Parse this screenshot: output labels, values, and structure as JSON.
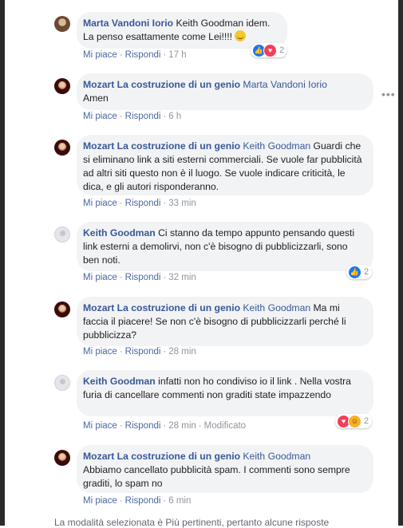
{
  "comments": [
    {
      "author": "Marta Vandoni Iorio",
      "tag": "",
      "text": " Keith Goodman idem. La penso esattamente come Lei!!!! ",
      "like": "Mi piace",
      "reply": "Rispondi",
      "time": "17 h",
      "reactions": {
        "icons": [
          "like-icon",
          "love-icon"
        ],
        "count": "2"
      }
    },
    {
      "author": "Mozart La costruzione di un genio",
      "tag": " Marta Vandoni Iorio",
      "text": "Amen",
      "like": "Mi piace",
      "reply": "Rispondi",
      "time": "6 h"
    },
    {
      "author": "Mozart La costruzione di un genio",
      "tag": " Keith Goodman",
      "text": " Guardi che si eliminano link a siti esterni commerciali. Se vuole far pubblicità ad altri siti questo non è il luogo. Se vuole indicare criticità, le dica, e gli autori risponderanno.",
      "like": "Mi piace",
      "reply": "Rispondi",
      "time": "33 min"
    },
    {
      "author": "Keith Goodman",
      "tag": "",
      "text": " Ci stanno da tempo appunto pensando questi link esterni a demolirvi, non c'è bisogno di pubblicizzarli, sono ben noti.",
      "like": "Mi piace",
      "reply": "Rispondi",
      "time": "32 min",
      "reactions": {
        "icons": [
          "like-icon"
        ],
        "count": "2"
      }
    },
    {
      "author": "Mozart La costruzione di un genio",
      "tag": " Keith Goodman",
      "text": " Ma mi faccia il piacere! Se non c'è bisogno di pubblicizzarli perché li pubblicizza?",
      "like": "Mi piace",
      "reply": "Rispondi",
      "time": "28 min"
    },
    {
      "author": "Keith Goodman",
      "tag": "",
      "text": " infatti non ho condiviso io il link . Nella vostra furia di cancellare commenti non graditi state impazzendo",
      "like": "Mi piace",
      "reply": "Rispondi",
      "time": "28 min",
      "edited": "Modificato",
      "reactions": {
        "icons": [
          "love-icon",
          "haha-icon"
        ],
        "count": "2"
      }
    },
    {
      "author": "Mozart La costruzione di un genio",
      "tag": " Keith Goodman",
      "text": "Abbiamo cancellato pubblicità spam. I commenti sono sempre graditi, lo spam no",
      "like": "Mi piace",
      "reply": "Rispondi",
      "time": "6 min"
    }
  ],
  "footer": "La modalità selezionata è Più pertinenti, pertanto alcune risposte",
  "colors": {
    "link": "#385898",
    "bubble": "#f2f3f5",
    "meta": "#90949c"
  }
}
